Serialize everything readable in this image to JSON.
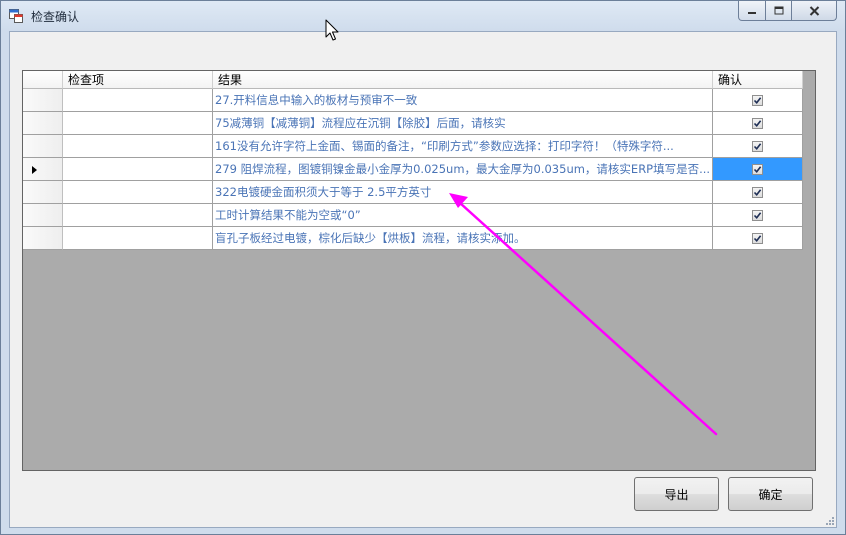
{
  "window": {
    "title": "检查确认"
  },
  "grid": {
    "columns": [
      {
        "key": "item",
        "label": "检查项"
      },
      {
        "key": "result",
        "label": "结果"
      },
      {
        "key": "confirm",
        "label": "确认"
      }
    ],
    "rows": [
      {
        "item": "",
        "result": "27.开料信息中输入的板材与预审不一致",
        "confirmed": true,
        "selected": false
      },
      {
        "item": "",
        "result": "75减薄铜【减薄铜】流程应在沉铜【除胶】后面，请核实",
        "confirmed": true,
        "selected": false
      },
      {
        "item": "",
        "result": "161没有允许字符上金面、锡面的备注，“印刷方式”参数应选择：打印字符！（特殊字符...",
        "confirmed": true,
        "selected": false
      },
      {
        "item": "",
        "result": "279 阻焊流程，图镀铜镍金最小金厚为0.025um，最大金厚为0.035um，请核实ERP填写是否...",
        "confirmed": true,
        "selected": true
      },
      {
        "item": "",
        "result": "322电镀硬金面积须大于等于 2.5平方英寸",
        "confirmed": true,
        "selected": false
      },
      {
        "item": "",
        "result": "工时计算结果不能为空或“0”",
        "confirmed": true,
        "selected": false
      },
      {
        "item": "",
        "result": "盲孔子板经过电镀，棕化后缺少【烘板】流程，请核实添加。",
        "confirmed": true,
        "selected": false
      }
    ]
  },
  "buttons": {
    "export": "导出",
    "ok": "确定"
  },
  "colors": {
    "annotation": "#ff00ff",
    "selection": "#3399ff",
    "result_text": "#4a74b6"
  }
}
